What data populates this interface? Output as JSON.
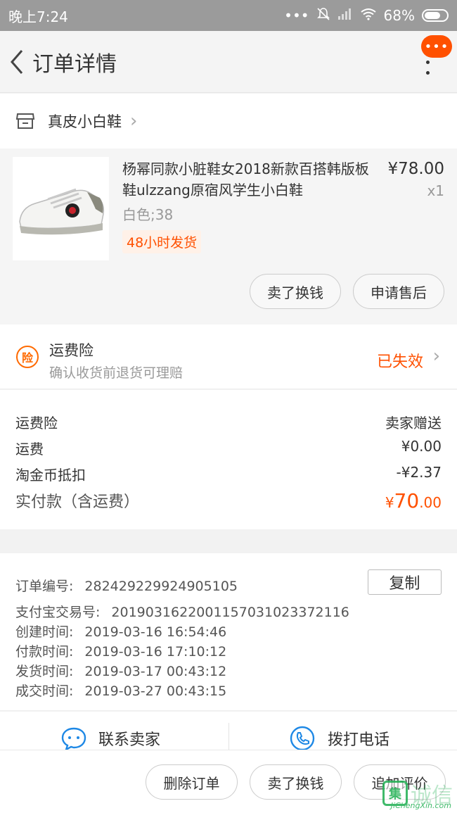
{
  "statusbar": {
    "time": "晚上7:24",
    "signal_dots": "•••",
    "battery": "68%"
  },
  "navbar": {
    "title": "订单详情",
    "more_badge": "•••"
  },
  "shop": {
    "name": "真皮小白鞋"
  },
  "item": {
    "title": "杨幂同款小脏鞋女2018新款百搭韩版板鞋ulzzang原宿风学生小白鞋",
    "price": "¥78.00",
    "qty": "x1",
    "sku": "白色;38",
    "tag": "48小时发货",
    "btn_sell": "卖了换钱",
    "btn_aftersale": "申请售后"
  },
  "insurance": {
    "badge": "险",
    "title": "运费险",
    "subtitle": "确认收货前退货可理赔",
    "status": "已失效"
  },
  "fees": {
    "rows": [
      {
        "label": "运费险",
        "value": "卖家赠送"
      },
      {
        "label": "运费",
        "value": "¥0.00"
      },
      {
        "label": "淘金币抵扣",
        "value": "-¥2.37"
      }
    ],
    "total_label": "实付款（含运费）",
    "total_currency": "¥",
    "total_int": "70",
    "total_dec": ".00"
  },
  "order_info": {
    "copy_label": "复制",
    "lines": [
      {
        "label": "订单编号:",
        "value": "282429229924905105"
      },
      {
        "label": "支付宝交易号:",
        "value": "2019031622001157031023372116"
      },
      {
        "label": "创建时间:",
        "value": "2019-03-16 16:54:46"
      },
      {
        "label": "付款时间:",
        "value": "2019-03-16 17:10:12"
      },
      {
        "label": "发货时间:",
        "value": "2019-03-17 00:43:12"
      },
      {
        "label": "成交时间:",
        "value": "2019-03-27 00:43:15"
      }
    ]
  },
  "contact": {
    "seller": "联系卖家",
    "call": "拨打电话"
  },
  "bottombar": {
    "delete": "删除订单",
    "sell": "卖了换钱",
    "review": "追加评价"
  },
  "watermark": {
    "logo": "集",
    "text": "诚信",
    "url": "JiChengXin.com"
  },
  "colors": {
    "accent": "#ff5000",
    "statusbar": "#9b9b9b"
  }
}
